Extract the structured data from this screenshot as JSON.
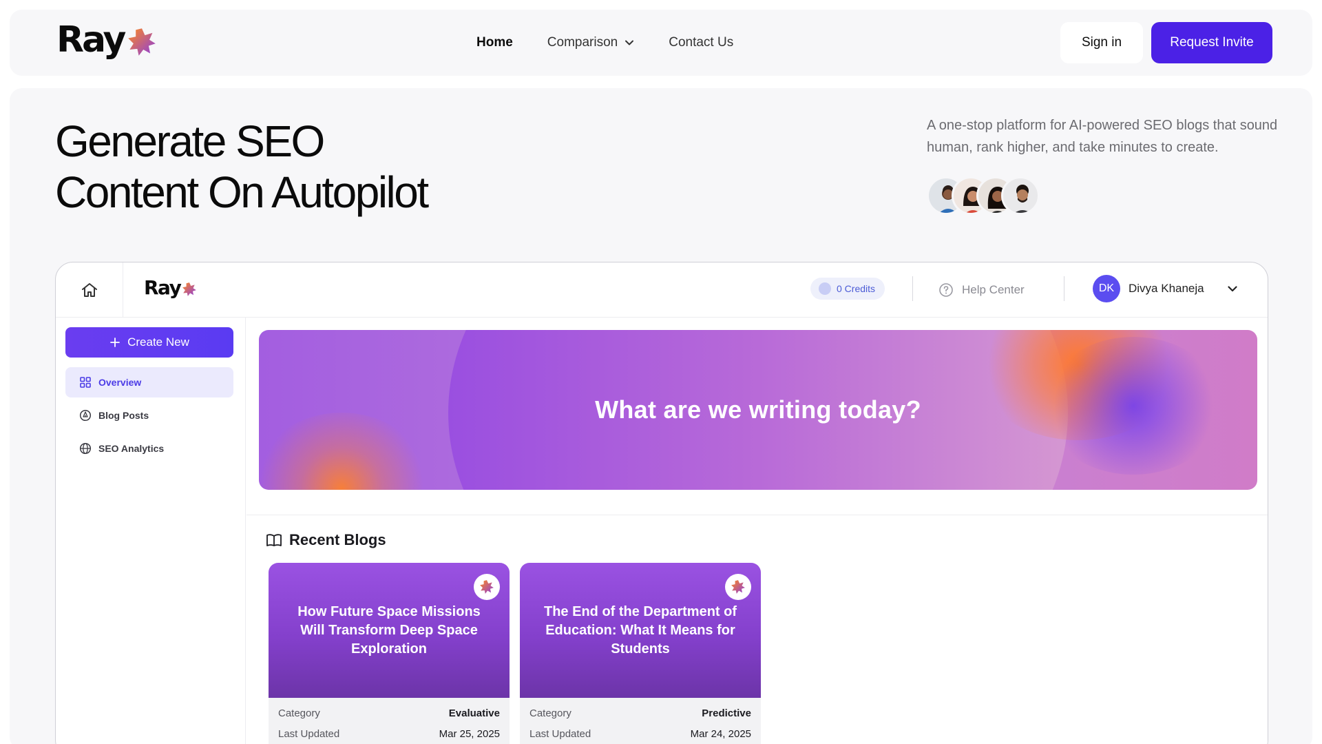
{
  "brand": {
    "name": "Ray"
  },
  "nav": {
    "links": [
      {
        "label": "Home"
      },
      {
        "label": "Comparison"
      },
      {
        "label": "Contact Us"
      }
    ],
    "signin_label": "Sign in",
    "invite_label": "Request Invite"
  },
  "hero": {
    "title_line1": "Generate SEO",
    "title_line2": "Content On Autopilot",
    "subtitle": "A one-stop platform for AI-powered SEO blogs that sound human, rank higher, and take minutes to create."
  },
  "app": {
    "brand": "Ray",
    "credits_label": "0 Credits",
    "help_label": "Help Center",
    "user": {
      "initials": "DK",
      "name": "Divya Khaneja"
    },
    "sidebar": {
      "create_label": "Create New",
      "items": [
        {
          "label": "Overview",
          "icon": "grid-icon",
          "active": true
        },
        {
          "label": "Blog Posts",
          "icon": "pen-nib-icon"
        },
        {
          "label": "SEO Analytics",
          "icon": "globe-icon"
        }
      ]
    },
    "banner_text": "What are we writing today?",
    "recent_title": "Recent Blogs",
    "cards": [
      {
        "title": "How Future Space Missions Will Transform Deep Space Exploration",
        "category_label": "Category",
        "category": "Evaluative",
        "updated_label": "Last Updated",
        "updated": "Mar 25, 2025"
      },
      {
        "title": "The End of the Department of Education: What It Means for Students",
        "category_label": "Category",
        "category": "Predictive",
        "updated_label": "Last Updated",
        "updated": "Mar 24, 2025"
      }
    ]
  },
  "colors": {
    "accent": "#4b21e6",
    "brand_orange": "#f26a1b",
    "brand_purple": "#8a3be0"
  }
}
